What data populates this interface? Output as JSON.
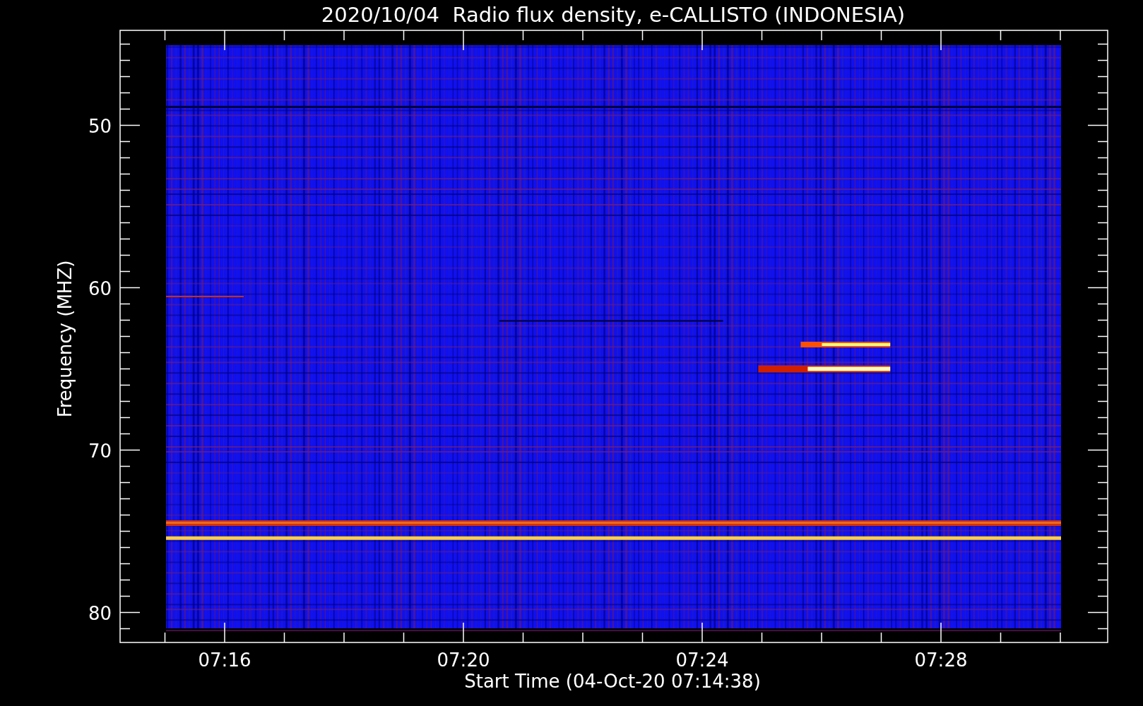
{
  "title": "2020/10/04  Radio flux density, e-CALLISTO (INDONESIA)",
  "y_axis": {
    "label": "Frequency (MHZ)",
    "tick_labels": [
      "50",
      "60",
      "70",
      "80"
    ]
  },
  "x_axis": {
    "label": "Start Time (04-Oct-20 07:14:38)",
    "tick_labels": [
      "07:16",
      "07:20",
      "07:24",
      "07:28"
    ]
  }
}
